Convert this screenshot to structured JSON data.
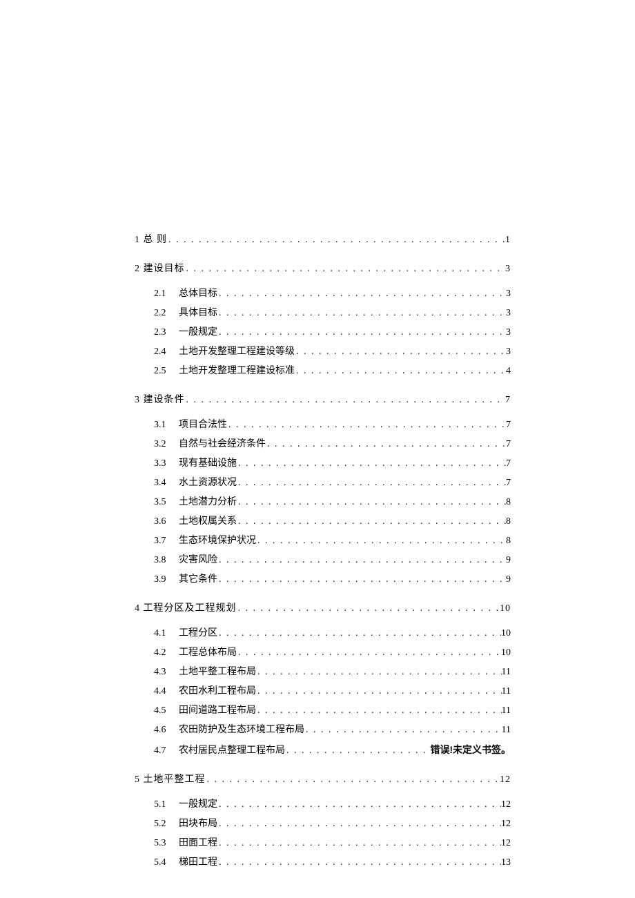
{
  "toc": [
    {
      "kind": "section",
      "num": "1",
      "title": "总 则",
      "page": "1"
    },
    {
      "kind": "section",
      "num": "2",
      "title": "建设目标",
      "page": "3"
    },
    {
      "kind": "sub",
      "num": "2.1",
      "title": "总体目标",
      "page": "3"
    },
    {
      "kind": "sub",
      "num": "2.2",
      "title": "具体目标",
      "page": "3"
    },
    {
      "kind": "sub",
      "num": "2.3",
      "title": "一般规定",
      "page": "3"
    },
    {
      "kind": "sub",
      "num": "2.4",
      "title": "土地开发整理工程建设等级",
      "page": "3"
    },
    {
      "kind": "sub",
      "num": "2.5",
      "title": "土地开发整理工程建设标准",
      "page": "4"
    },
    {
      "kind": "section",
      "num": "3",
      "title": "建设条件",
      "page": "7"
    },
    {
      "kind": "sub",
      "num": "3.1",
      "title": "项目合法性",
      "page": "7"
    },
    {
      "kind": "sub",
      "num": "3.2",
      "title": "自然与社会经济条件",
      "page": "7"
    },
    {
      "kind": "sub",
      "num": "3.3",
      "title": "现有基础设施",
      "page": "7"
    },
    {
      "kind": "sub",
      "num": "3.4",
      "title": "水土资源状况",
      "page": "7"
    },
    {
      "kind": "sub",
      "num": "3.5",
      "title": "土地潜力分析",
      "page": "8"
    },
    {
      "kind": "sub",
      "num": "3.6",
      "title": "土地权属关系",
      "page": "8"
    },
    {
      "kind": "sub",
      "num": "3.7",
      "title": "生态环境保护状况",
      "page": "8"
    },
    {
      "kind": "sub",
      "num": "3.8",
      "title": "灾害风险",
      "page": "9"
    },
    {
      "kind": "sub",
      "num": "3.9",
      "title": "其它条件",
      "page": "9"
    },
    {
      "kind": "section",
      "num": "4",
      "title": "工程分区及工程规划",
      "page": "10"
    },
    {
      "kind": "sub",
      "num": "4.1",
      "title": "工程分区",
      "page": "10"
    },
    {
      "kind": "sub",
      "num": "4.2",
      "title": "工程总体布局",
      "page": "10"
    },
    {
      "kind": "sub",
      "num": "4.3",
      "title": "土地平整工程布局",
      "page": "11"
    },
    {
      "kind": "sub",
      "num": "4.4",
      "title": "农田水利工程布局",
      "page": "11"
    },
    {
      "kind": "sub",
      "num": "4.5",
      "title": "田间道路工程布局",
      "page": "11"
    },
    {
      "kind": "sub",
      "num": "4.6",
      "title": "农田防护及生态环境工程布局",
      "page": "11"
    },
    {
      "kind": "sub",
      "num": "4.7",
      "title": "农村居民点整理工程布局",
      "page": "错误!未定义书签。",
      "error": true
    },
    {
      "kind": "section",
      "num": "5",
      "title": "土地平整工程",
      "page": "12"
    },
    {
      "kind": "sub",
      "num": "5.1",
      "title": "一般规定",
      "page": "12"
    },
    {
      "kind": "sub",
      "num": "5.2",
      "title": "田块布局",
      "page": "12"
    },
    {
      "kind": "sub",
      "num": "5.3",
      "title": "田面工程",
      "page": "12"
    },
    {
      "kind": "sub",
      "num": "5.4",
      "title": "梯田工程",
      "page": "13"
    }
  ]
}
